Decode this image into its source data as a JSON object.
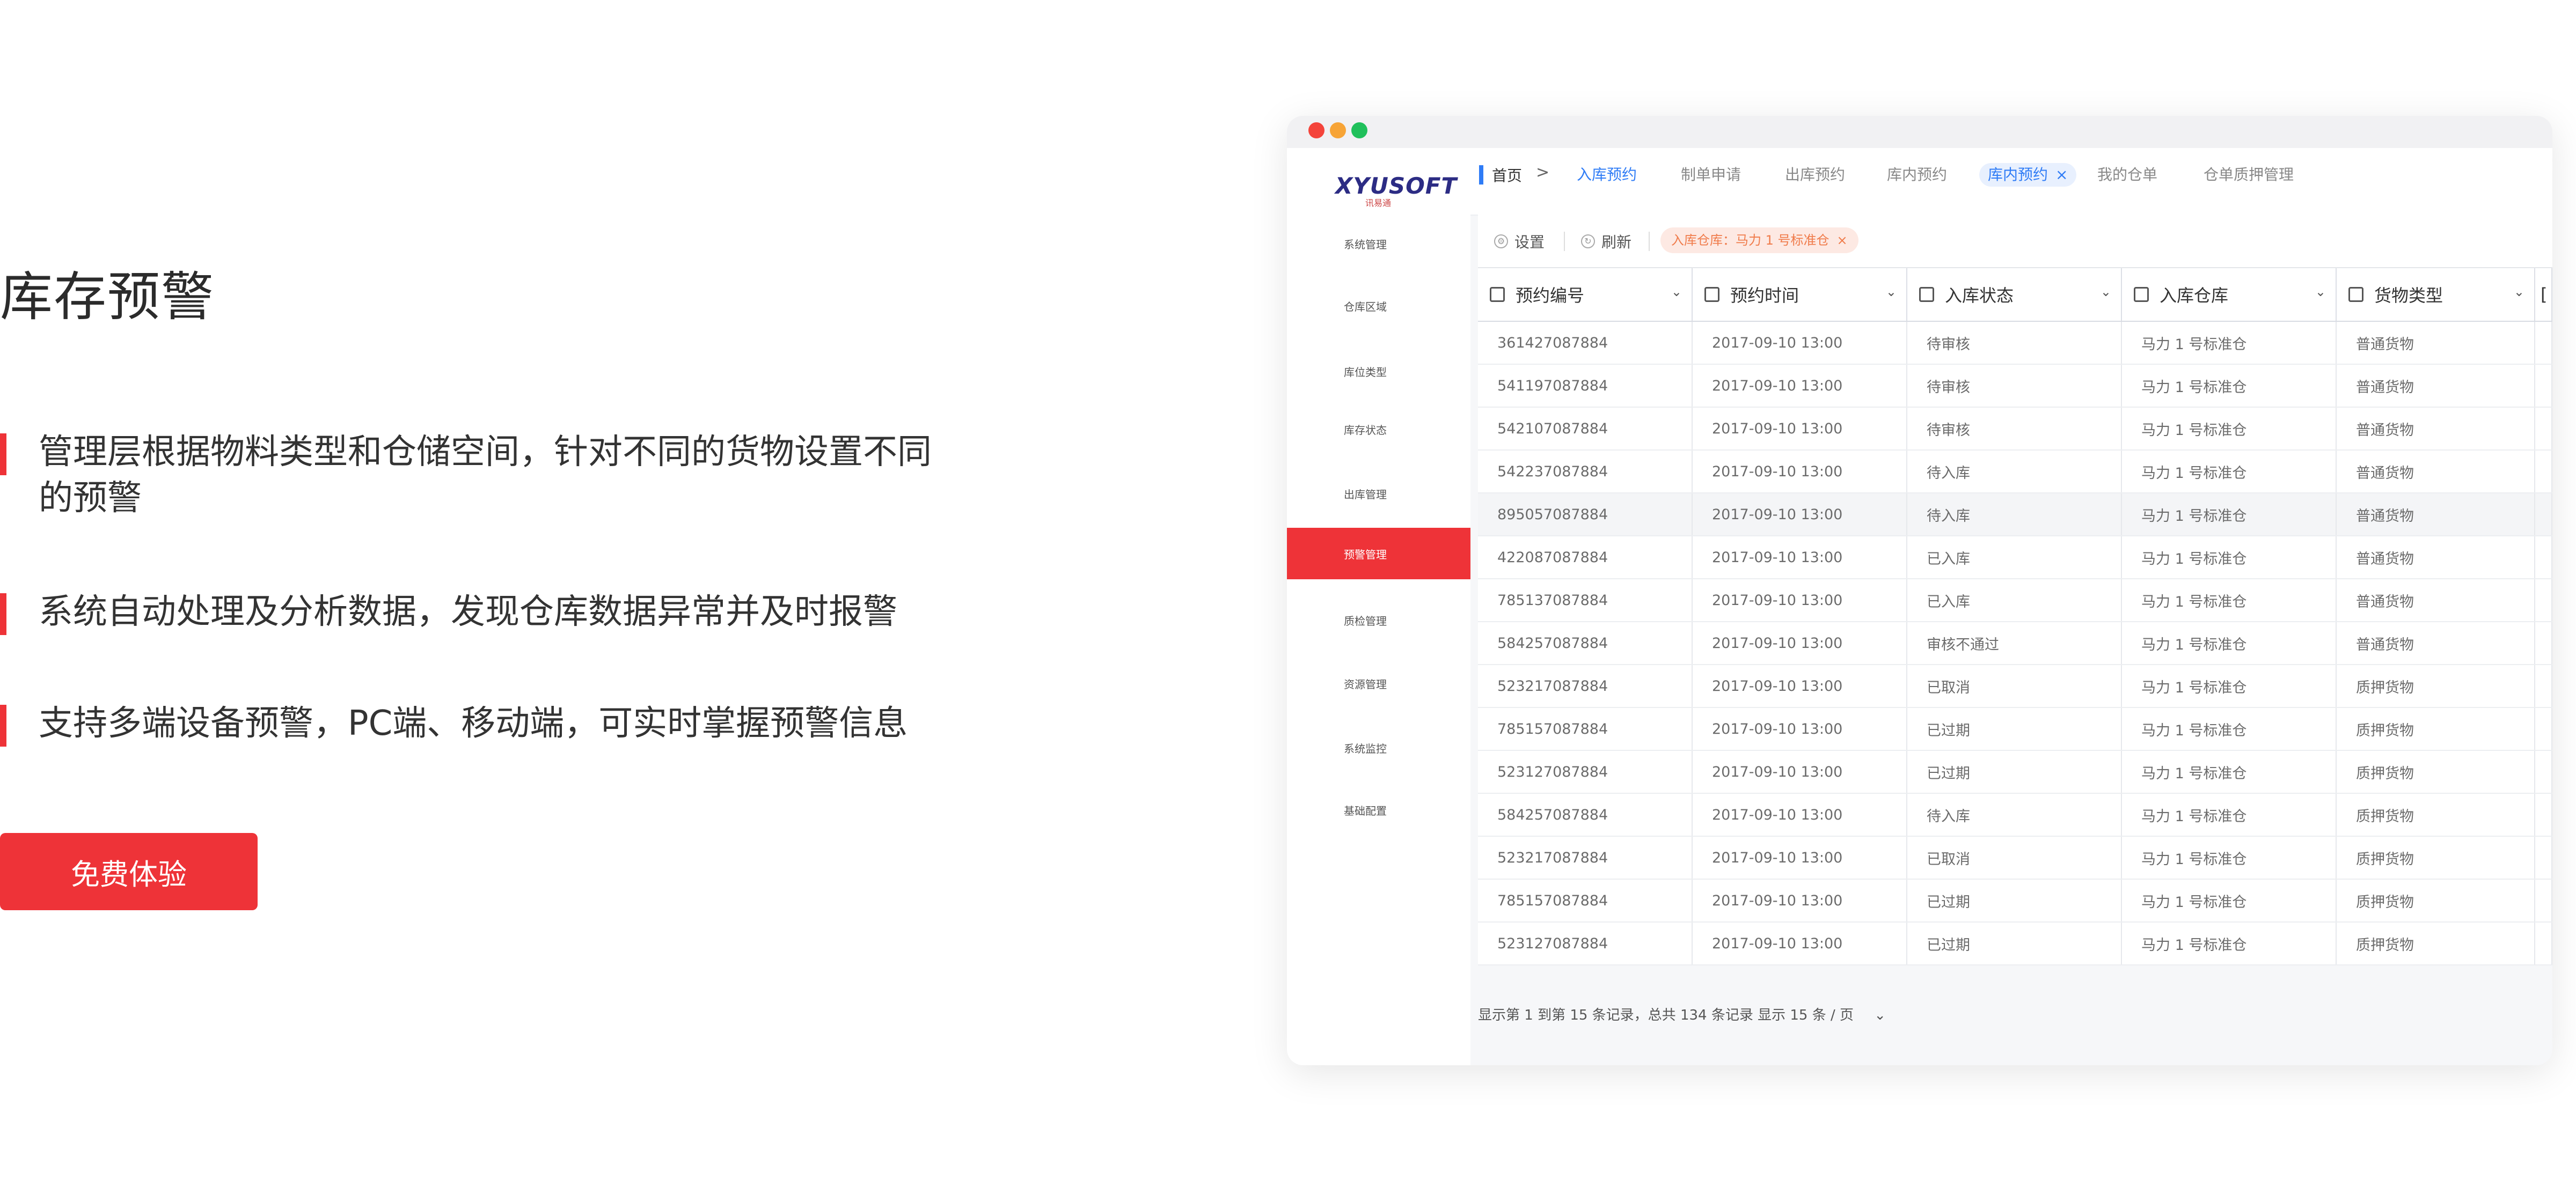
{
  "hero": {
    "title": "库存预警",
    "features": [
      "管理层根据物料类型和仓储空间，针对不同的货物设置不同的预警",
      "系统自动处理及分析数据，发现仓库数据异常并及时报警",
      "支持多端设备预警，PC端、移动端，可实时掌握预警信息"
    ],
    "cta_label": "免费体验",
    "accent_color": "#ee3338"
  },
  "app": {
    "logo": {
      "brand": "XYUSOFT",
      "sub": "讯易通"
    },
    "sidebar": {
      "items": [
        {
          "label": "系统管理",
          "active": false
        },
        {
          "label": "仓库区域",
          "active": false
        },
        {
          "label": "库位类型",
          "active": false
        },
        {
          "label": "库存状态",
          "active": false
        },
        {
          "label": "出库管理",
          "active": false
        },
        {
          "label": "预警管理",
          "active": true
        },
        {
          "label": "质检管理",
          "active": false
        },
        {
          "label": "资源管理",
          "active": false
        },
        {
          "label": "系统监控",
          "active": false
        },
        {
          "label": "基础配置",
          "active": false
        }
      ]
    },
    "breadcrumb": {
      "home": "首页",
      "sep": ">"
    },
    "tabs": [
      {
        "label": "入库预约",
        "state": "active"
      },
      {
        "label": "制单申请",
        "state": "normal"
      },
      {
        "label": "出库预约",
        "state": "normal"
      },
      {
        "label": "库内预约",
        "state": "normal"
      },
      {
        "label": "库内预约",
        "state": "selected",
        "close": "×"
      },
      {
        "label": "我的仓单",
        "state": "normal"
      },
      {
        "label": "仓单质押管理",
        "state": "normal"
      }
    ],
    "toolbar": {
      "settings_label": "设置",
      "refresh_label": "刷新",
      "filter_tag": "入库仓库：马力 1 号标准仓",
      "filter_close": "×"
    },
    "table": {
      "columns": [
        "预约编号",
        "预约时间",
        "入库状态",
        "入库仓库",
        "货物类型"
      ],
      "rows": [
        [
          "361427087884",
          "2017-09-10 13:00",
          "待审核",
          "马力 1 号标准仓",
          "普通货物"
        ],
        [
          "541197087884",
          "2017-09-10 13:00",
          "待审核",
          "马力 1 号标准仓",
          "普通货物"
        ],
        [
          "542107087884",
          "2017-09-10 13:00",
          "待审核",
          "马力 1 号标准仓",
          "普通货物"
        ],
        [
          "542237087884",
          "2017-09-10 13:00",
          "待入库",
          "马力 1 号标准仓",
          "普通货物"
        ],
        [
          "895057087884",
          "2017-09-10 13:00",
          "待入库",
          "马力 1 号标准仓",
          "普通货物"
        ],
        [
          "422087087884",
          "2017-09-10 13:00",
          "已入库",
          "马力 1 号标准仓",
          "普通货物"
        ],
        [
          "785137087884",
          "2017-09-10 13:00",
          "已入库",
          "马力 1 号标准仓",
          "普通货物"
        ],
        [
          "584257087884",
          "2017-09-10 13:00",
          "审核不通过",
          "马力 1 号标准仓",
          "普通货物"
        ],
        [
          "523217087884",
          "2017-09-10 13:00",
          "已取消",
          "马力 1 号标准仓",
          "质押货物"
        ],
        [
          "785157087884",
          "2017-09-10 13:00",
          "已过期",
          "马力 1 号标准仓",
          "质押货物"
        ],
        [
          "523127087884",
          "2017-09-10 13:00",
          "已过期",
          "马力 1 号标准仓",
          "质押货物"
        ],
        [
          "584257087884",
          "2017-09-10 13:00",
          "待入库",
          "马力 1 号标准仓",
          "质押货物"
        ],
        [
          "523217087884",
          "2017-09-10 13:00",
          "已取消",
          "马力 1 号标准仓",
          "质押货物"
        ],
        [
          "785157087884",
          "2017-09-10 13:00",
          "已过期",
          "马力 1 号标准仓",
          "质押货物"
        ],
        [
          "523127087884",
          "2017-09-10 13:00",
          "已过期",
          "马力 1 号标准仓",
          "质押货物"
        ]
      ],
      "highlighted_row": 4
    },
    "footer": {
      "summary": "显示第 1 到第 15 条记录，总共 134 条记录",
      "show_label": "显示",
      "page_size": "15 条 / 页"
    }
  }
}
